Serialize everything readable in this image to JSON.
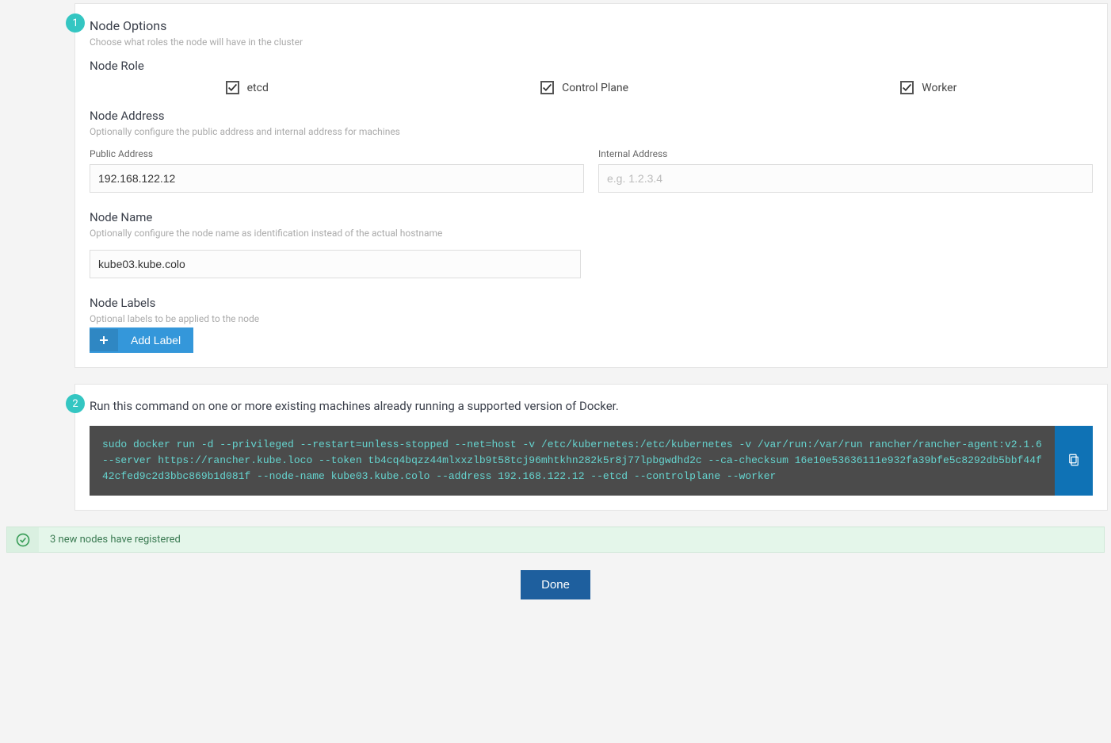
{
  "step1": {
    "badge": "1",
    "title": "Node Options",
    "subtitle": "Choose what roles the node will have in the cluster",
    "role": {
      "label": "Node Role",
      "options": {
        "etcd": "etcd",
        "control_plane": "Control Plane",
        "worker": "Worker"
      }
    },
    "address": {
      "label": "Node Address",
      "subtitle": "Optionally configure the public address and internal address for machines",
      "public_label": "Public Address",
      "public_value": "192.168.122.12",
      "internal_label": "Internal Address",
      "internal_placeholder": "e.g. 1.2.3.4"
    },
    "name": {
      "label": "Node Name",
      "subtitle": "Optionally configure the node name as identification instead of the actual hostname",
      "value": "kube03.kube.colo"
    },
    "labels": {
      "label": "Node Labels",
      "subtitle": "Optional labels to be applied to the node",
      "add_button": "Add Label"
    }
  },
  "step2": {
    "badge": "2",
    "instruction": "Run this command on one or more existing machines already running a supported version of Docker.",
    "command": "sudo docker run -d --privileged --restart=unless-stopped --net=host -v /etc/kubernetes:/etc/kubernetes -v /var/run:/var/run rancher/rancher-agent:v2.1.6 --server https://rancher.kube.loco --token tb4cq4bqzz44mlxxzlb9t58tcj96mhtkhn282k5r8j77lpbgwdhd2c --ca-checksum 16e10e53636111e932fa39bfe5c8292db5bbf44f42cfed9c2d3bbc869b1d081f --node-name kube03.kube.colo --address 192.168.122.12 --etcd --controlplane --worker"
  },
  "status": {
    "message": "3 new nodes have registered"
  },
  "done_button": "Done"
}
